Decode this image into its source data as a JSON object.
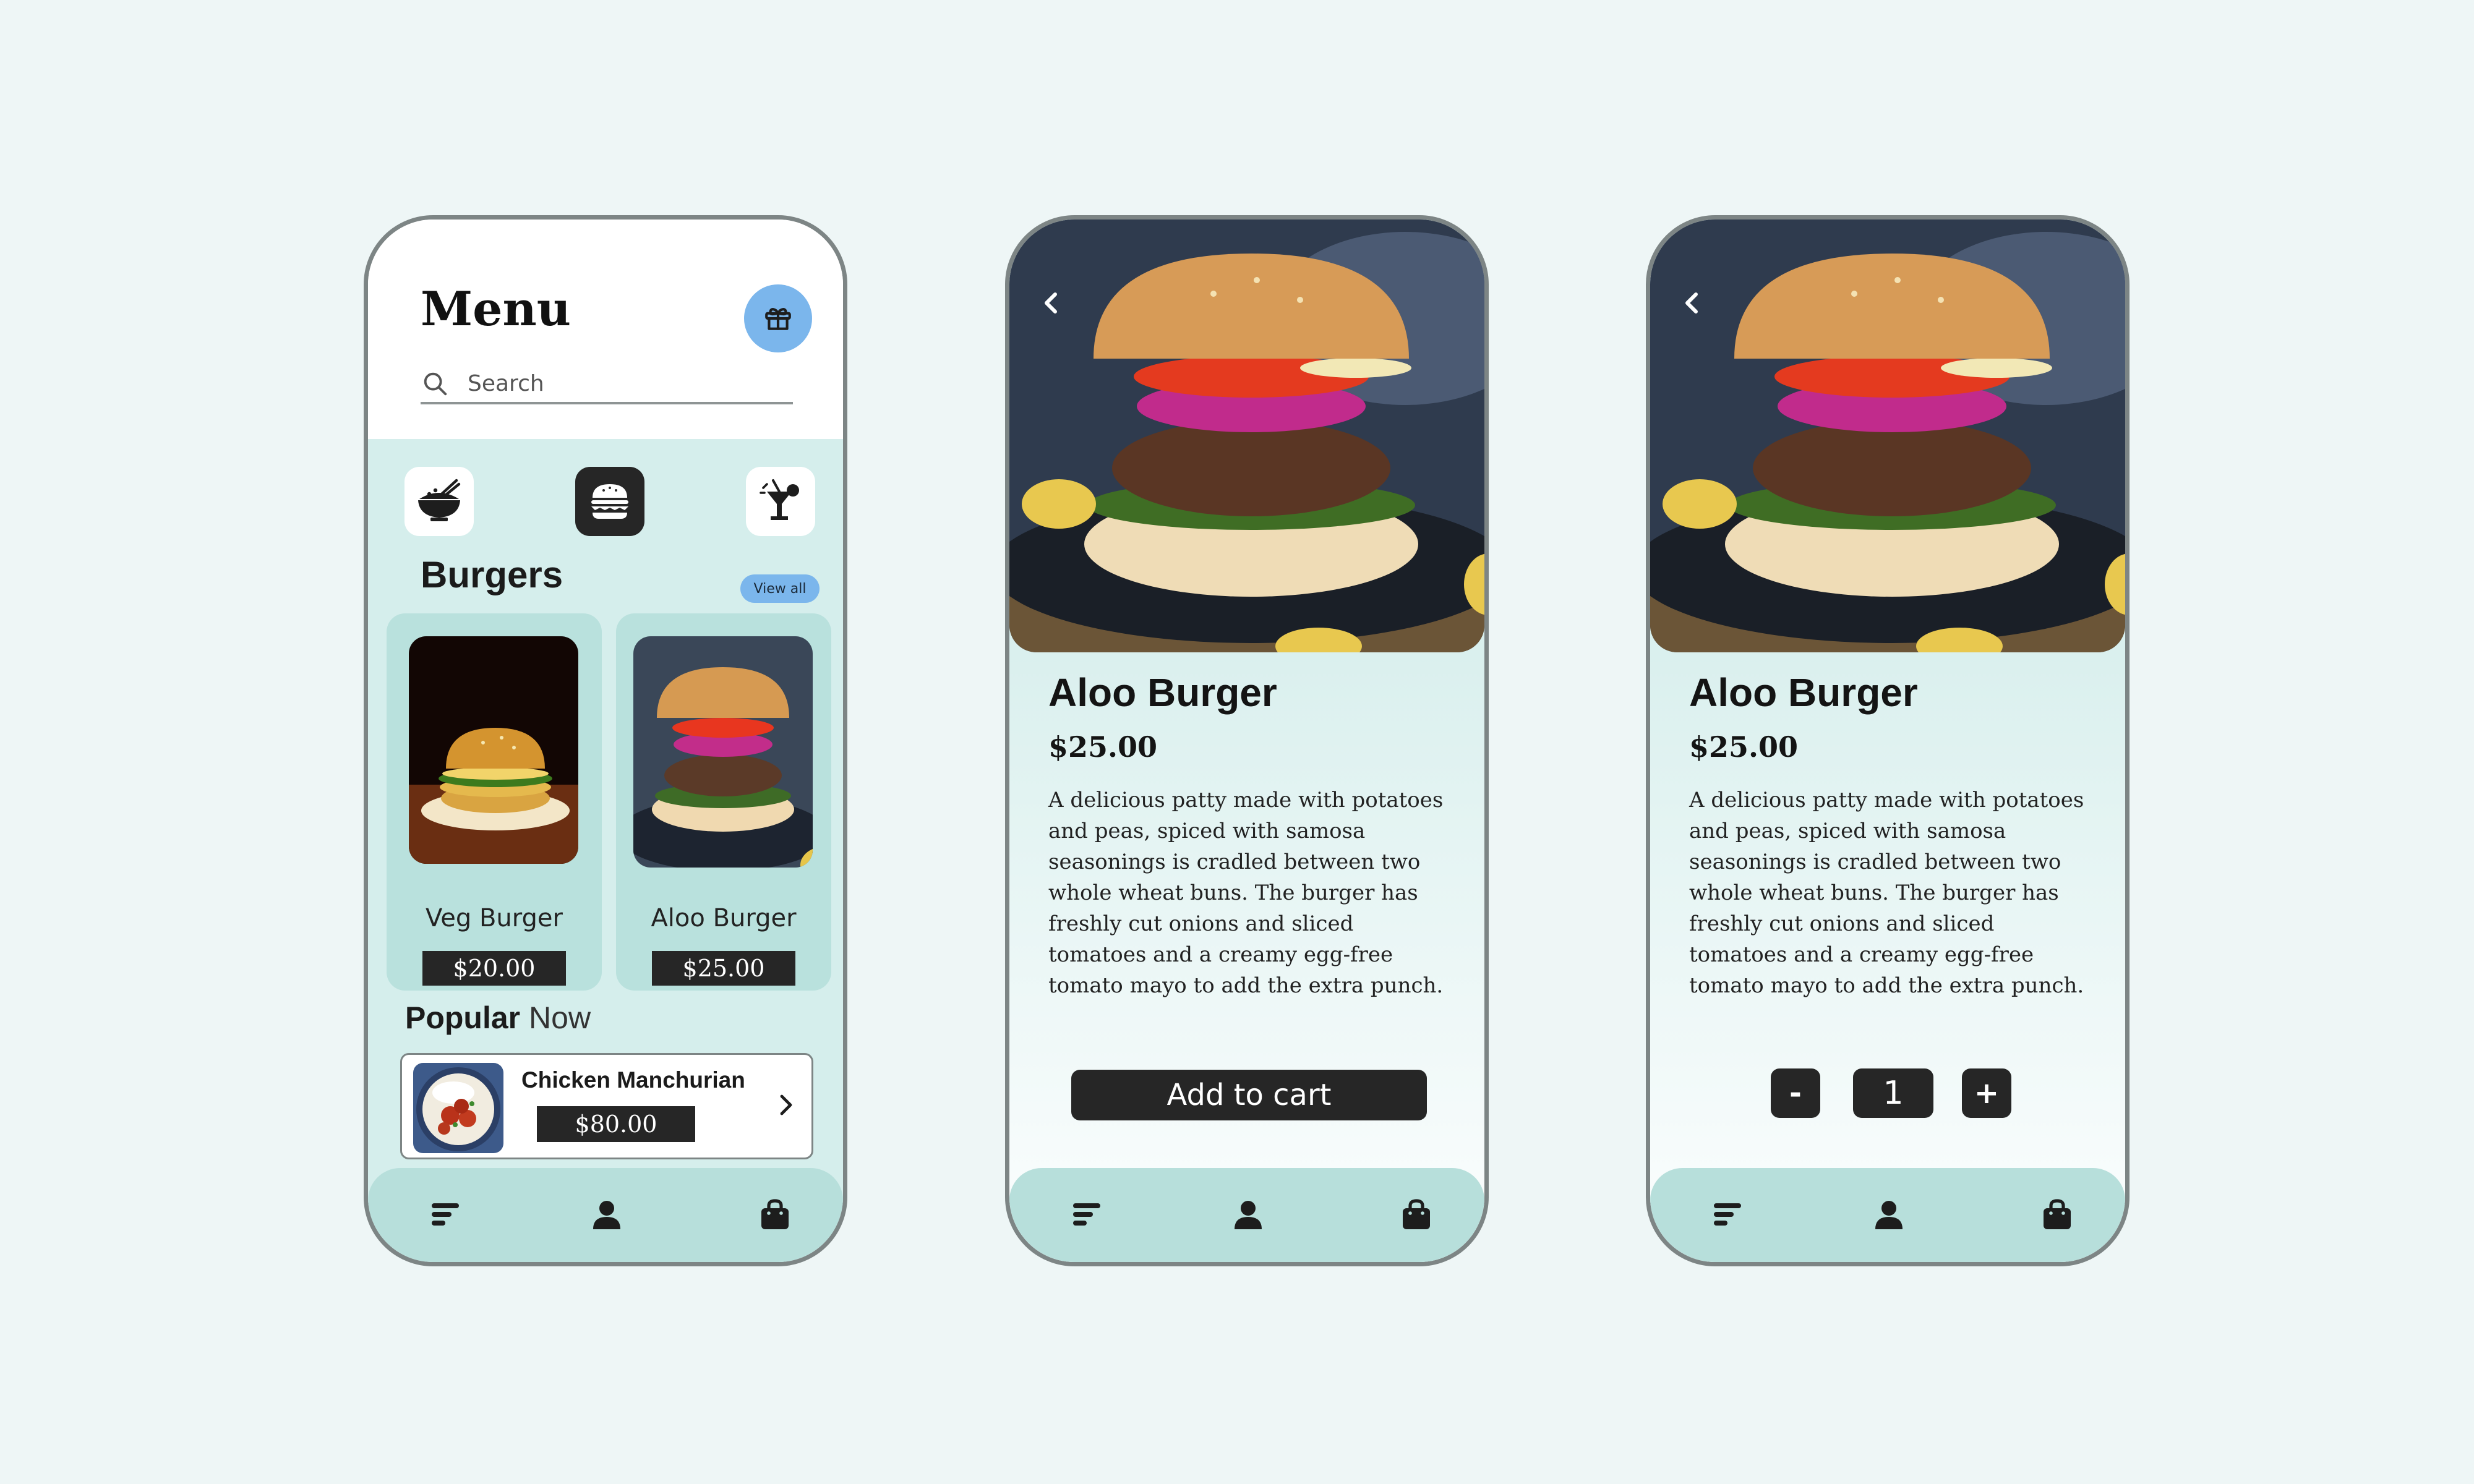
{
  "menu_screen": {
    "title": "Menu",
    "search": {
      "placeholder": "Search",
      "value": ""
    },
    "categories": [
      {
        "icon": "rice-bowl-icon",
        "active": false
      },
      {
        "icon": "burger-icon",
        "active": true
      },
      {
        "icon": "drink-icon",
        "active": false
      }
    ],
    "section_title": "Burgers",
    "view_all_label": "View all",
    "products": [
      {
        "name": "Veg Burger",
        "price": "$20.00"
      },
      {
        "name": "Aloo Burger",
        "price": "$25.00"
      }
    ],
    "popular": {
      "title_bold": "Popular",
      "title_rest": " Now",
      "item": {
        "name": "Chicken Manchurian",
        "price": "$80.00"
      }
    }
  },
  "detail_screen": {
    "title": "Aloo Burger",
    "price": "$25.00",
    "description": "A delicious patty made with potatoes and peas, spiced with samosa seasonings is cradled between two whole wheat buns. The burger has freshly cut onions and sliced tomatoes and a creamy egg-free tomato mayo to add the extra punch.",
    "add_to_cart_label": "Add to cart",
    "quantity": {
      "minus_label": "-",
      "value": "1",
      "plus_label": "+"
    }
  },
  "bottom_nav": {
    "items": [
      {
        "icon": "menu-lines-icon"
      },
      {
        "icon": "profile-icon"
      },
      {
        "icon": "shopping-bag-icon"
      }
    ]
  },
  "colors": {
    "page_background": "#eef6f6",
    "panel_mint": "#d5eeec",
    "card_mint": "#b9e1dd",
    "nav_mint": "#b7dfdb",
    "accent_blue": "#7bb6ec",
    "dark": "#262626"
  }
}
